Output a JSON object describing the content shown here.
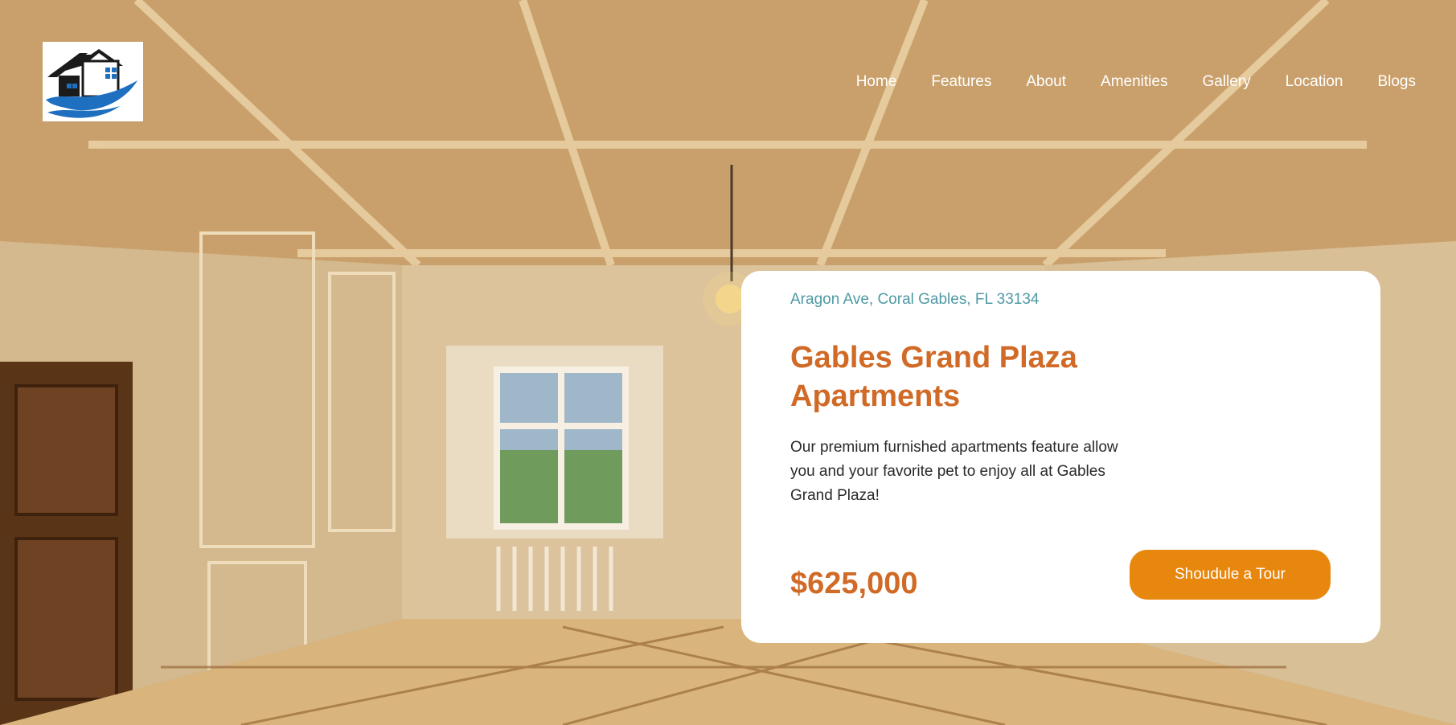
{
  "header": {
    "logo_name": "house-logo",
    "nav": [
      {
        "label": "Home"
      },
      {
        "label": "Features"
      },
      {
        "label": "About"
      },
      {
        "label": "Amenities"
      },
      {
        "label": "Gallery"
      },
      {
        "label": "Location"
      },
      {
        "label": "Blogs"
      }
    ]
  },
  "listing": {
    "address": "Aragon Ave, Coral Gables, FL 33134",
    "title": "Gables Grand Plaza Apartments",
    "description": "Our premium furnished apartments feature allow you and your favorite pet to enjoy all at Gables Grand Plaza!",
    "price": "$625,000",
    "cta_label": "Shoudule a Tour"
  },
  "colors": {
    "accent": "#d06a26",
    "button": "#e8870e",
    "address": "#4f9aa4"
  }
}
